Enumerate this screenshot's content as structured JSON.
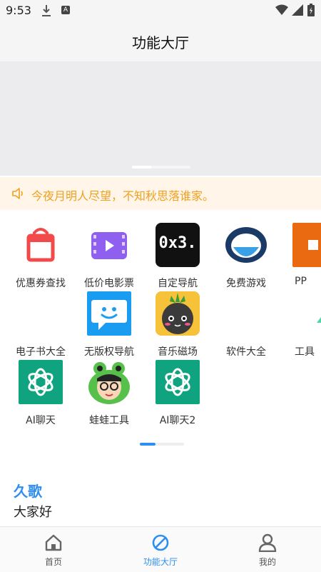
{
  "status_bar": {
    "time": "9:53"
  },
  "header": {
    "title": "功能大厅"
  },
  "notice": {
    "text": "今夜月明人尽望，不知秋思落谁家。"
  },
  "tools": [
    {
      "label": "优惠券查找",
      "icon": "shopping-bag-icon"
    },
    {
      "label": "低价电影票",
      "icon": "film-icon"
    },
    {
      "label": "自定导航",
      "icon": "0x3-logo",
      "logo_text": "0x3."
    },
    {
      "label": "免费游戏",
      "icon": "game-icon"
    },
    {
      "label": "PP",
      "icon": "ppt-icon"
    },
    {
      "label": "电子书大全",
      "icon": "ebook-icon"
    },
    {
      "label": "无版权导航",
      "icon": "smile-chat-icon"
    },
    {
      "label": "音乐磁场",
      "icon": "fruit-music-icon"
    },
    {
      "label": "软件大全",
      "icon": "software-icon"
    },
    {
      "label": "工具",
      "icon": "tool-icon"
    },
    {
      "label": "AI聊天",
      "icon": "ai-chat-icon"
    },
    {
      "label": "蛙蛙工具",
      "icon": "frog-icon"
    },
    {
      "label": "AI聊天2",
      "icon": "ai-chat-icon"
    }
  ],
  "section": {
    "title": "久歌",
    "subtitle": "大家好"
  },
  "tabbar": {
    "tabs": [
      {
        "label": "首页",
        "icon": "home-icon",
        "active": false
      },
      {
        "label": "功能大厅",
        "icon": "compass-icon",
        "active": true
      },
      {
        "label": "我的",
        "icon": "profile-icon",
        "active": false
      }
    ]
  },
  "colors": {
    "accent": "#2e8ff0",
    "notice_text": "#f0a020",
    "notice_bg": "#fff5e8",
    "ai_green": "#10a37f"
  }
}
